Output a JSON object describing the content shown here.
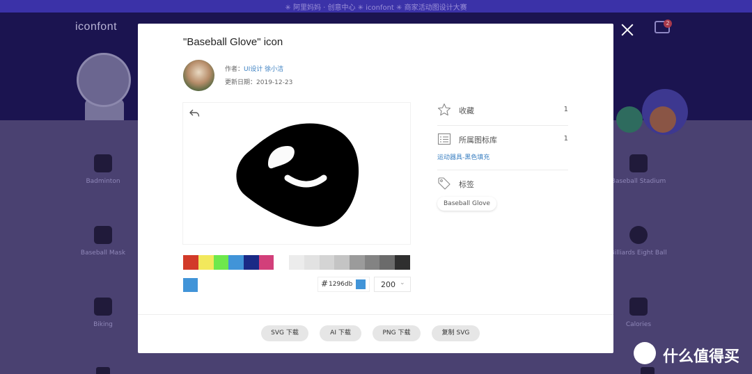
{
  "background": {
    "banner_text": "✳ 阿里妈妈 · 创意中心 ✳ iconfont ✳ 商家活动图设计大赛",
    "logo": "iconfont",
    "cart_count": "2",
    "icons": [
      {
        "label": "Badminton"
      },
      {
        "label": "Baseball Stadium"
      },
      {
        "label": "Baseball Mask"
      },
      {
        "label": "Billiards Eight Ball"
      },
      {
        "label": "Biking"
      },
      {
        "label": "Calories"
      }
    ]
  },
  "modal": {
    "title": "\"Baseball Glove\" icon",
    "author_prefix": "作者：",
    "author_name": "UI设计 徐小洁",
    "date_prefix": "更新日期：",
    "date": "2019-12-23",
    "favorite_label": "收藏",
    "favorite_count": "1",
    "library_label": "所属图标库",
    "library_count": "1",
    "library_name": "运动器具-黑色填充",
    "tags_label": "标签",
    "tag": "Baseball Glove",
    "hex_prefix": "#",
    "hex_value": "1296db",
    "current_color": "#4194d8",
    "size_value": "200",
    "colors_palette": [
      "#d23a29",
      "#f2e85c",
      "#6ee84c",
      "#4194d8",
      "#1a2a86",
      "#d23f7a"
    ],
    "colors_gray": [
      "#ececec",
      "#e2e2e2",
      "#d4d4d4",
      "#c4c4c4",
      "#b2b2b2",
      "#9b9b9b",
      "#838383",
      "#6b6b6b",
      "#4f4f4f",
      "#2f2f2f"
    ],
    "buttons": {
      "svg": "SVG 下载",
      "ai": "AI 下载",
      "png": "PNG 下载",
      "copy": "复制 SVG"
    }
  },
  "watermark": {
    "text": "什么值得买"
  }
}
